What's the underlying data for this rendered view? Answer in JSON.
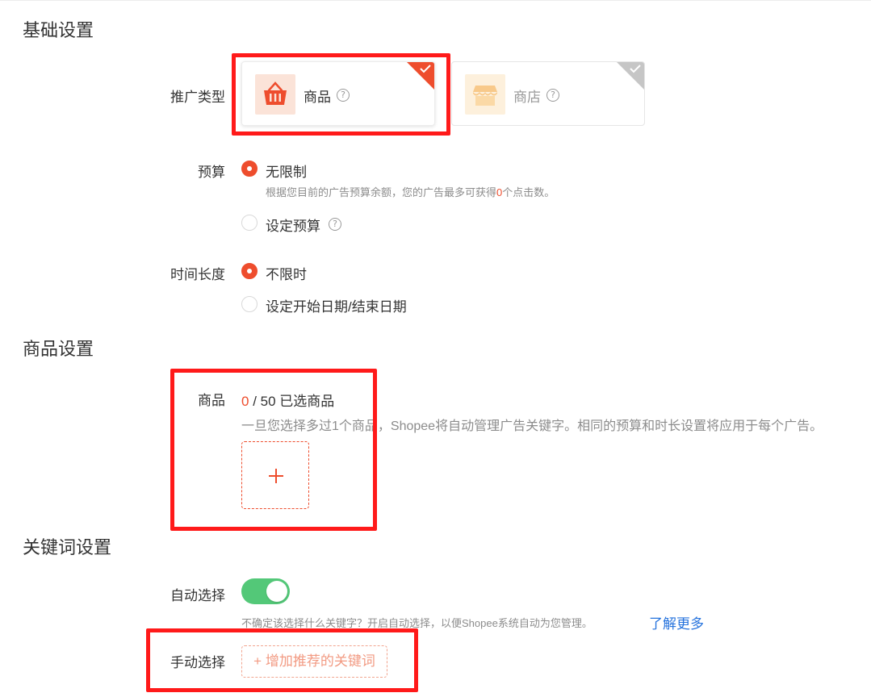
{
  "sections": {
    "basic": "基础设置",
    "product": "商品设置",
    "keyword": "关键词设置"
  },
  "promo_type": {
    "label": "推广类型",
    "options": [
      {
        "label": "商品",
        "icon": "basket-icon",
        "selected": true
      },
      {
        "label": "商店",
        "icon": "shop-icon",
        "selected": false
      }
    ]
  },
  "budget": {
    "label": "预算",
    "options": [
      {
        "label": "无限制",
        "checked": true
      },
      {
        "label": "设定预算",
        "checked": false
      }
    ],
    "hint_before": "根据您目前的广告预算余额，您的广告最多可获得",
    "hint_count": "0",
    "hint_after": "个点击数。"
  },
  "duration": {
    "label": "时间长度",
    "options": [
      {
        "label": "不限时",
        "checked": true
      },
      {
        "label": "设定开始日期/结束日期",
        "checked": false
      }
    ]
  },
  "products": {
    "label": "商品",
    "selected_count": "0",
    "count_rest": " / 50 已选商品",
    "hint": "一旦您选择多过1个商品，Shopee将自动管理广告关键字。相同的预算和时长设置将应用于每个广告。"
  },
  "keywords": {
    "auto_label": "自动选择",
    "auto_enabled": true,
    "auto_hint": "不确定该选择什么关键字？开启自动选择，以便Shopee系统自动为您管理。",
    "learn_more": "了解更多",
    "manual_label": "手动选择",
    "add_button": "+ 增加推荐的关键词"
  },
  "colors": {
    "accent": "#ee4d2d",
    "toggle_on": "#53c878",
    "link": "#2673dd",
    "annotation": "#ff1a1a"
  }
}
